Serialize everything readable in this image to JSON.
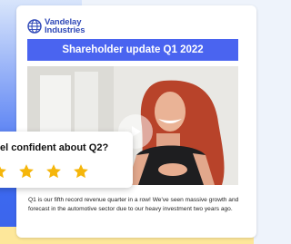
{
  "brand": {
    "line1": "Vandelay",
    "line2": "Industries"
  },
  "banner_title": "Shareholder update Q1 2022",
  "video": {
    "play_icon": "play-icon"
  },
  "survey": {
    "question": "el confident about Q2?",
    "star_count_visible": 4,
    "star_color": "#f5b60b"
  },
  "body_text": "Q1 is our fifth record revenue quarter in a row! We've seen massive growth and forecast in the automotive sector due to our heavy investment two years ago.",
  "colors": {
    "accent": "#4a64f0",
    "brand": "#3049b8"
  }
}
